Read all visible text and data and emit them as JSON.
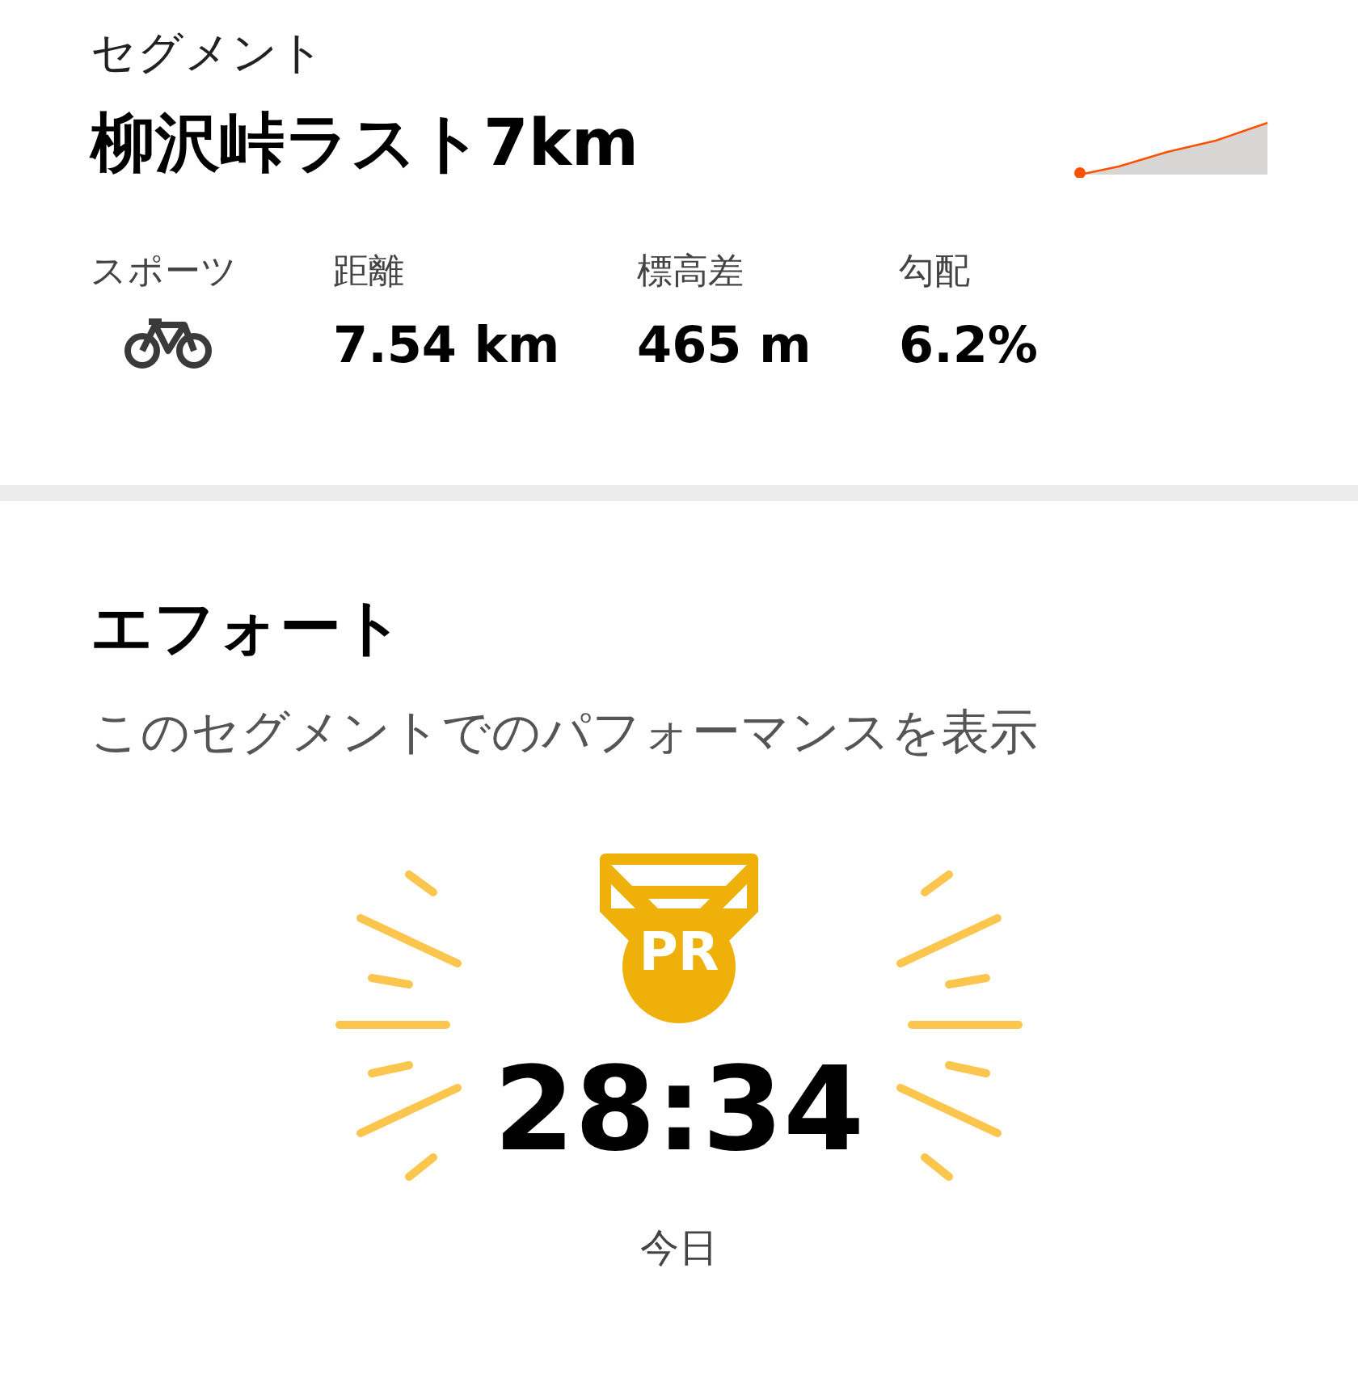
{
  "segment": {
    "label": "セグメント",
    "title": "柳沢峠ラスト7km",
    "stats": [
      {
        "kind": "icon",
        "label": "スポーツ"
      },
      {
        "kind": "text",
        "label": "距離",
        "value": "7.54 km"
      },
      {
        "kind": "text",
        "label": "標高差",
        "value": "465 m"
      },
      {
        "kind": "text",
        "label": "勾配",
        "value": "6.2%"
      }
    ]
  },
  "effort": {
    "title": "エフォート",
    "subtitle": "このセグメントでのパフォーマンスを表示",
    "badge": "PR",
    "time": "28:34",
    "date": "今日"
  }
}
